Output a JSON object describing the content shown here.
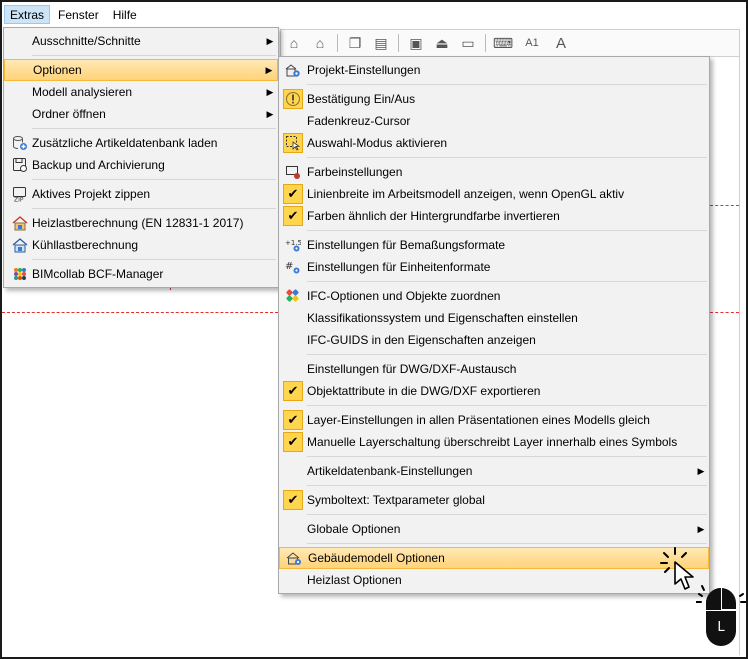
{
  "menubar": {
    "items": [
      {
        "label": "Extras"
      },
      {
        "label": "Fenster"
      },
      {
        "label": "Hilfe"
      }
    ]
  },
  "extras_menu": {
    "items": [
      {
        "label": "Ausschnitte/Schnitte",
        "icon": "none",
        "submenu": true
      },
      {
        "label": "Optionen",
        "icon": "none",
        "submenu": true
      },
      {
        "label": "Modell analysieren",
        "icon": "none",
        "submenu": true
      },
      {
        "label": "Ordner öffnen",
        "icon": "none",
        "submenu": true
      },
      {
        "label": "Zusätzliche Artikeldatenbank laden",
        "icon": "database-add-icon"
      },
      {
        "label": "Backup und Archivierung",
        "icon": "backup-icon"
      },
      {
        "label": "Aktives Projekt zippen",
        "icon": "zip-icon"
      },
      {
        "label": "Heizlastberechnung (EN 12831-1 2017)",
        "icon": "heating-load-icon"
      },
      {
        "label": "Kühllastberechnung",
        "icon": "cooling-load-icon"
      },
      {
        "label": "BIMcollab BCF-Manager",
        "icon": "bimcollab-icon"
      }
    ]
  },
  "optionen_submenu": {
    "items": [
      {
        "label": "Projekt-Einstellungen",
        "icon": "project-settings-icon"
      },
      {
        "label": "Bestätigung Ein/Aus",
        "icon": "confirmation-icon"
      },
      {
        "label": "Fadenkreuz-Cursor",
        "icon": "none"
      },
      {
        "label": "Auswahl-Modus aktivieren",
        "icon": "selection-mode-icon"
      },
      {
        "label": "Farbeinstellungen",
        "icon": "color-settings-icon"
      },
      {
        "label": "Linienbreite im Arbeitsmodell anzeigen, wenn OpenGL aktiv",
        "icon": "checkmark-icon",
        "checked": true
      },
      {
        "label": "Farben ähnlich der Hintergrundfarbe invertieren",
        "icon": "checkmark-icon",
        "checked": true
      },
      {
        "label": "Einstellungen für Bemaßungsformate",
        "icon": "dimension-format-icon"
      },
      {
        "label": "Einstellungen für Einheitenformate",
        "icon": "unit-format-icon"
      },
      {
        "label": "IFC-Optionen und Objekte zuordnen",
        "icon": "ifc-icon"
      },
      {
        "label": "Klassifikationssystem und Eigenschaften einstellen",
        "icon": "none"
      },
      {
        "label": "IFC-GUIDS in den Eigenschaften anzeigen",
        "icon": "none"
      },
      {
        "label": "Einstellungen für DWG/DXF-Austausch",
        "icon": "none"
      },
      {
        "label": "Objektattribute in die DWG/DXF exportieren",
        "icon": "checkmark-icon",
        "checked": true
      },
      {
        "label": "Layer-Einstellungen in allen Präsentationen eines Modells gleich",
        "icon": "checkmark-icon",
        "checked": true
      },
      {
        "label": "Manuelle Layerschaltung überschreibt Layer innerhalb eines Symbols",
        "icon": "checkmark-icon",
        "checked": true
      },
      {
        "label": "Artikeldatenbank-Einstellungen",
        "icon": "none",
        "submenu": true
      },
      {
        "label": "Symboltext: Textparameter global",
        "icon": "checkmark-icon",
        "checked": true
      },
      {
        "label": "Globale Optionen",
        "icon": "none",
        "submenu": true
      },
      {
        "label": "Gebäudemodell Optionen",
        "icon": "building-model-icon",
        "highlighted": true
      },
      {
        "label": "Heizlast Optionen",
        "icon": "none"
      }
    ]
  },
  "toolbar": {
    "text_tool_label": "A1",
    "font_tool_label": "A"
  },
  "mouse_hint": {
    "button_label": "L"
  },
  "colors": {
    "highlight": "#ffd37a",
    "check_bg": "#ffd54d",
    "menubar_active": "#cce4f7",
    "canvas_line": "#e03030"
  }
}
